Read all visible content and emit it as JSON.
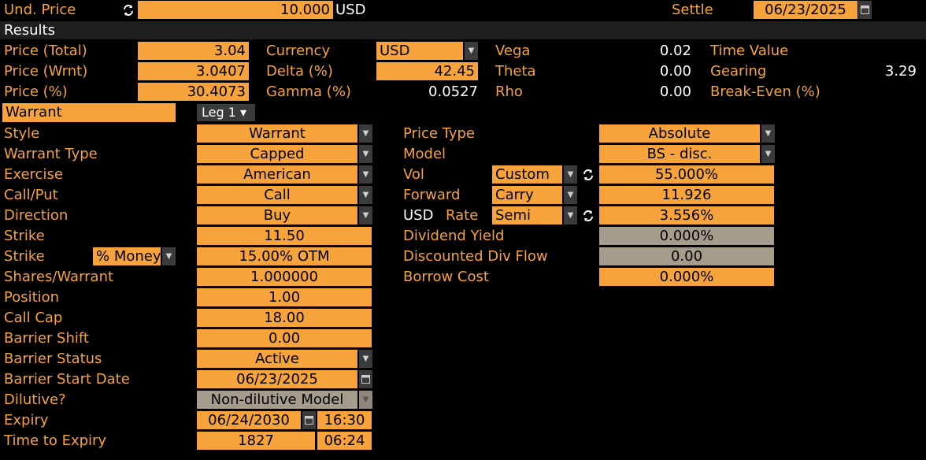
{
  "header": {
    "und_price_label": "Und. Price",
    "und_price_value": "10.000",
    "und_price_currency": "USD",
    "settle_label": "Settle",
    "settle_value": "06/23/2025"
  },
  "results": {
    "title": "Results",
    "price_total_label": "Price (Total)",
    "price_total_value": "3.04",
    "price_wrnt_label": "Price (Wrnt)",
    "price_wrnt_value": "3.0407",
    "price_pct_label": "Price (%)",
    "price_pct_value": "30.4073",
    "currency_label": "Currency",
    "currency_value": "USD",
    "delta_label": "Delta (%)",
    "delta_value": "42.45",
    "gamma_label": "Gamma (%)",
    "gamma_value": "0.0527",
    "vega_label": "Vega",
    "vega_value": "0.02",
    "theta_label": "Theta",
    "theta_value": "0.00",
    "rho_label": "Rho",
    "rho_value": "0.00",
    "time_value_label": "Time Value",
    "gearing_label": "Gearing",
    "gearing_value": "3.29",
    "break_even_label": "Break-Even (%)"
  },
  "warrant_tab": {
    "label": "Warrant",
    "leg_label": "Leg 1 ▾"
  },
  "left": {
    "style_label": "Style",
    "style_value": "Warrant",
    "warrant_type_label": "Warrant Type",
    "warrant_type_value": "Capped",
    "exercise_label": "Exercise",
    "exercise_value": "American",
    "call_put_label": "Call/Put",
    "call_put_value": "Call",
    "direction_label": "Direction",
    "direction_value": "Buy",
    "strike_label": "Strike",
    "strike_value": "11.50",
    "strike2_label": "Strike",
    "strike2_mode": "% Money",
    "strike2_value": "15.00% OTM",
    "shares_label": "Shares/Warrant",
    "shares_value": "1.000000",
    "position_label": "Position",
    "position_value": "1.00",
    "call_cap_label": "Call Cap",
    "call_cap_value": "18.00",
    "barrier_shift_label": "Barrier Shift",
    "barrier_shift_value": "0.00",
    "barrier_status_label": "Barrier Status",
    "barrier_status_value": "Active",
    "barrier_start_label": "Barrier Start Date",
    "barrier_start_value": "06/23/2025",
    "dilutive_label": "Dilutive?",
    "dilutive_value": "Non-dilutive Model",
    "expiry_label": "Expiry",
    "expiry_date": "06/24/2030",
    "expiry_time": "16:30",
    "tte_label": "Time to Expiry",
    "tte_days": "1827",
    "tte_time": "06:24"
  },
  "right": {
    "price_type_label": "Price Type",
    "price_type_value": "Absolute",
    "model_label": "Model",
    "model_value": "BS - disc.",
    "vol_label": "Vol",
    "vol_mode": "Custom",
    "vol_value": "55.000%",
    "forward_label": "Forward",
    "forward_mode": "Carry",
    "forward_value": "11.926",
    "rate_ccy": "USD",
    "rate_label": "Rate",
    "rate_mode": "Semi",
    "rate_value": "3.556%",
    "div_yield_label": "Dividend Yield",
    "div_yield_value": "0.000%",
    "disc_div_label": "Discounted Div Flow",
    "disc_div_value": "0.00",
    "borrow_label": "Borrow Cost",
    "borrow_value": "0.000%"
  },
  "colors": {
    "accent": "#f5a33a",
    "background": "#000000",
    "disabled": "#a59c8c"
  }
}
